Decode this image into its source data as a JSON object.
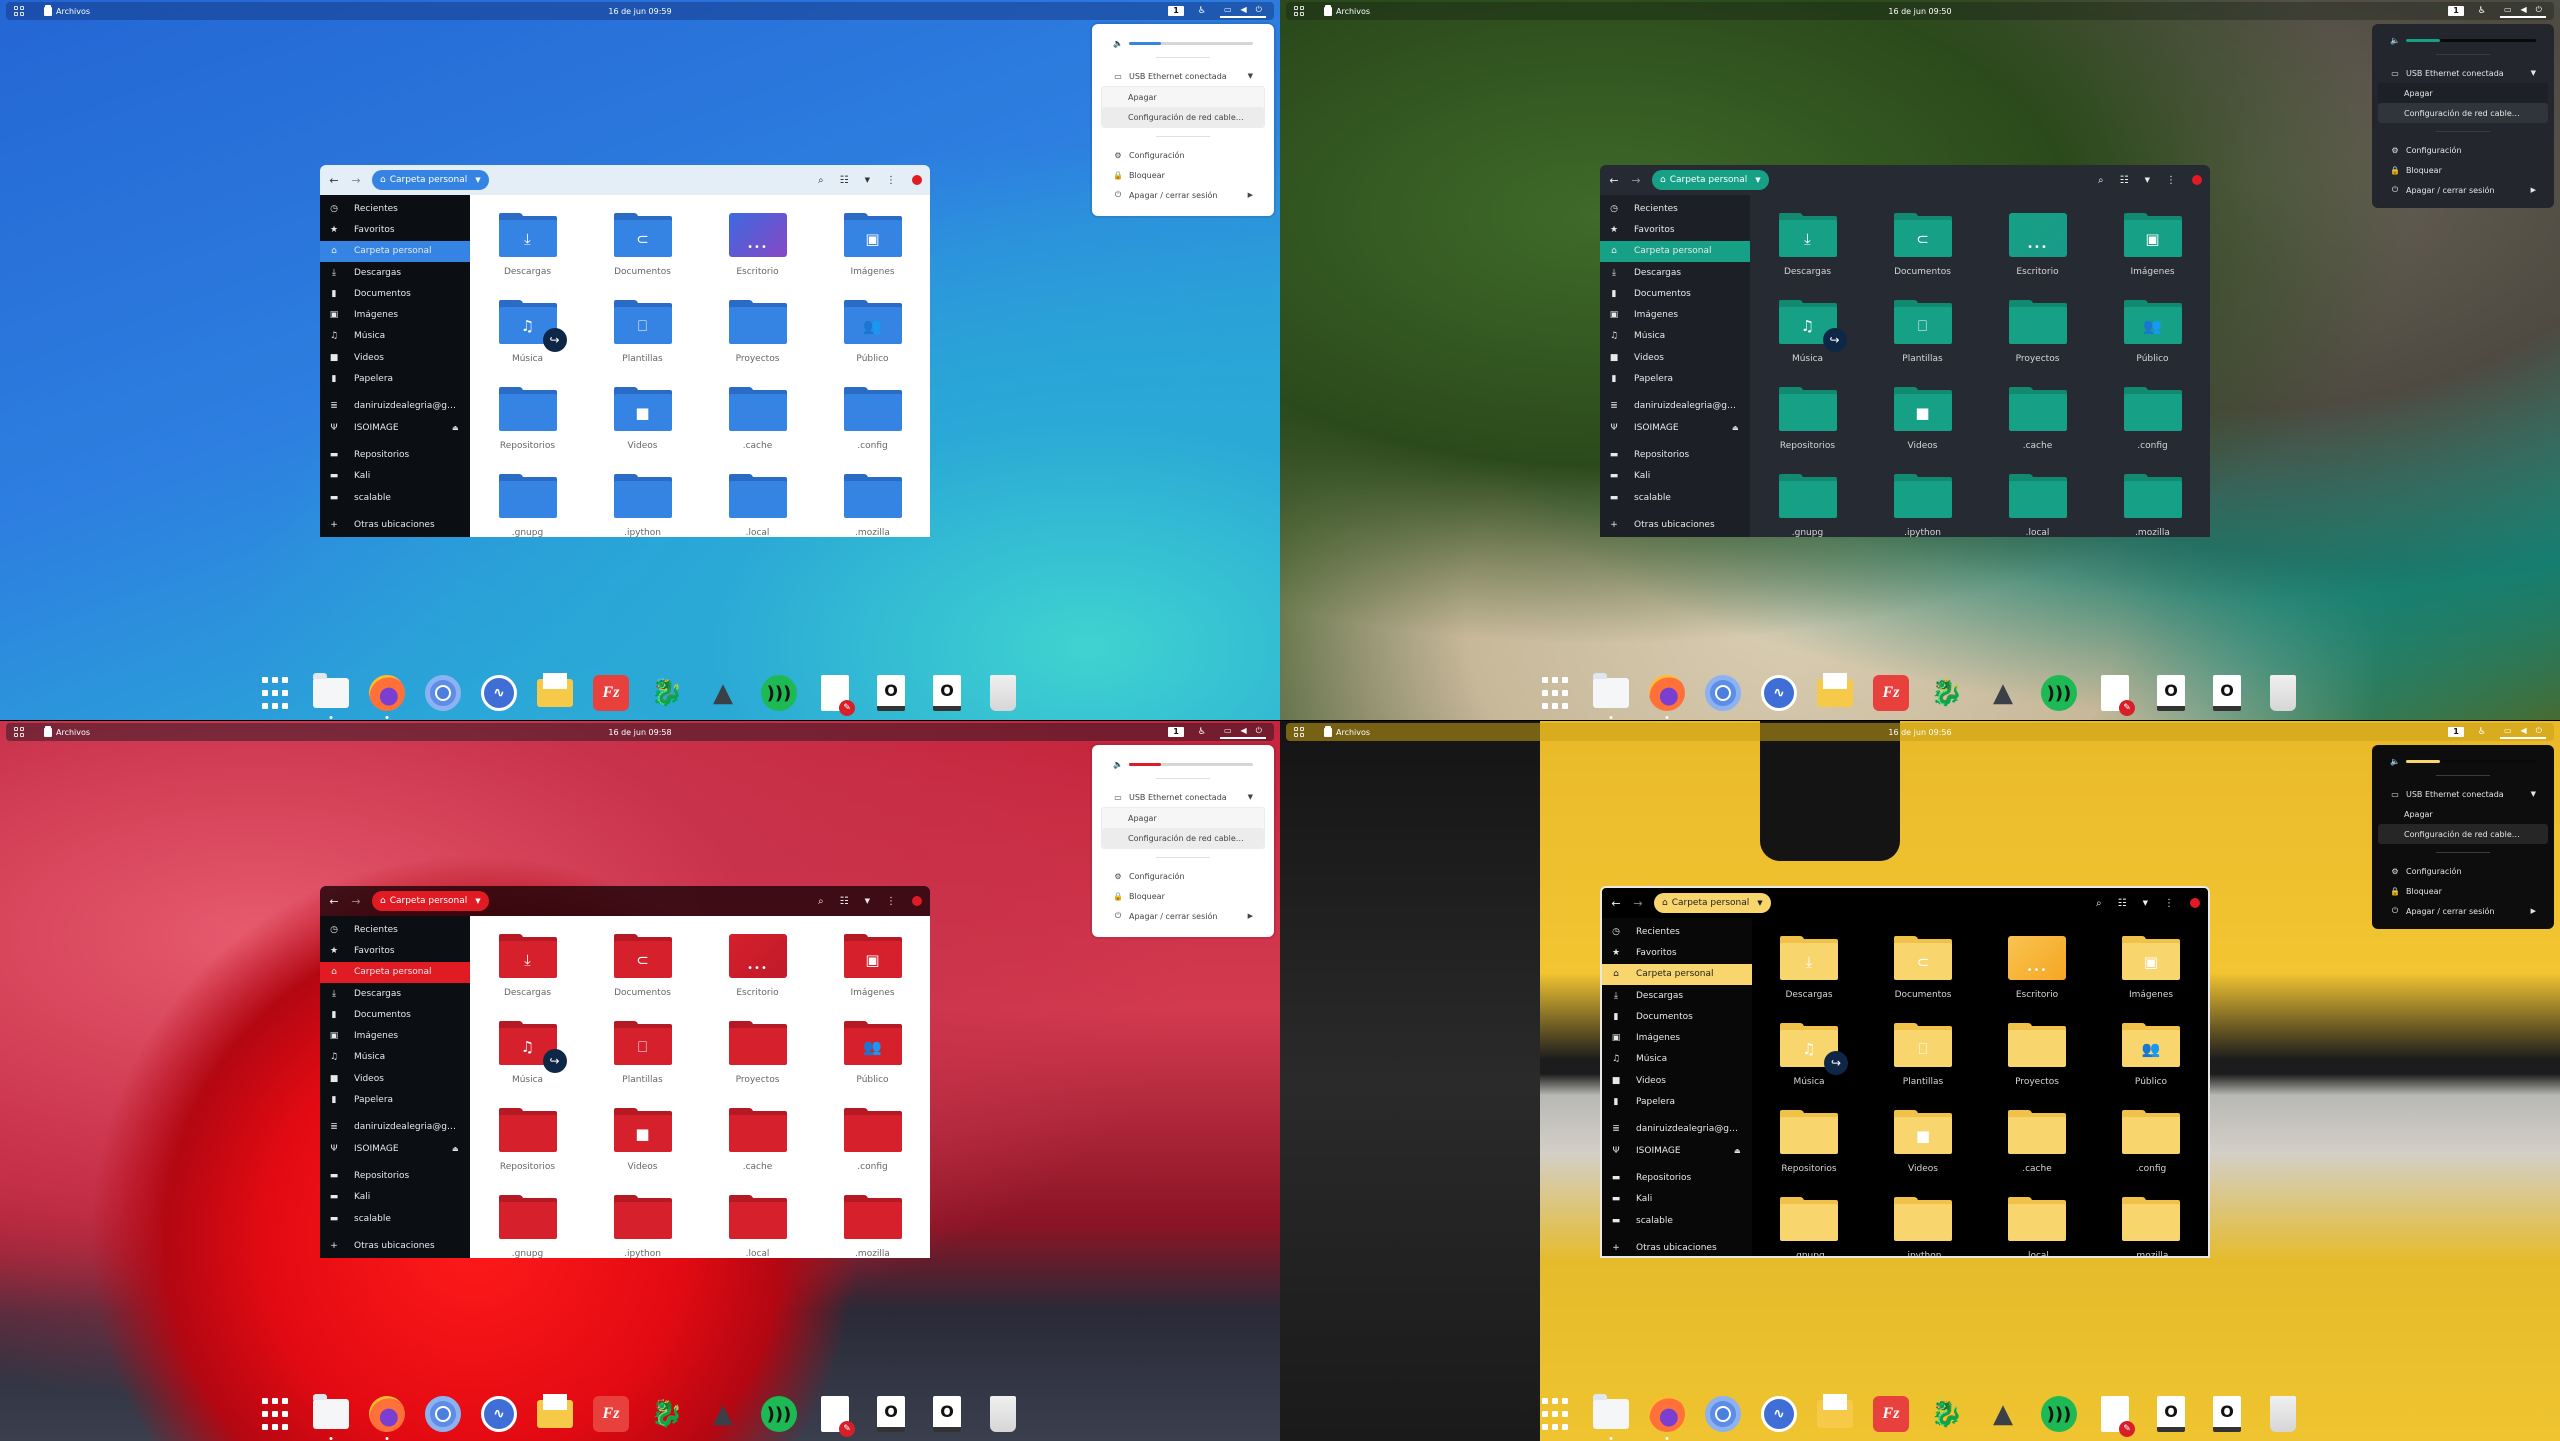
{
  "screens": [
    {
      "theme": "light-blue",
      "accent": "#3584e4",
      "folder_color": "#3584e4",
      "folder_dark": "#2a6cc5",
      "desktop_gradient": [
        "#3d6ae0",
        "#8847c5"
      ],
      "topbar": {
        "app_name": "Archivos",
        "clock": "16 de jun  09:59",
        "workspace": "1"
      },
      "volume_level": 0.26
    },
    {
      "theme": "dark-teal",
      "accent": "#16a085",
      "folder_color": "#16a085",
      "folder_dark": "#128a72",
      "desktop_gradient": [
        "#16a085",
        "#1a9a8a"
      ],
      "topbar": {
        "app_name": "Archivos",
        "clock": "16 de jun  09:50",
        "workspace": "1"
      },
      "volume_level": 0.26
    },
    {
      "theme": "light-red",
      "accent": "#e01b24",
      "folder_color": "#d6202c",
      "folder_dark": "#b51923",
      "desktop_gradient": [
        "#d6202c",
        "#c01a2a"
      ],
      "topbar": {
        "app_name": "Archivos",
        "clock": "16 de jun  09:58",
        "workspace": "1"
      },
      "volume_level": 0.26
    },
    {
      "theme": "dark-yellow",
      "accent": "#f9d56e",
      "folder_color": "#f9d56e",
      "folder_dark": "#f0c24a",
      "desktop_gradient": [
        "#f9c450",
        "#f5a623"
      ],
      "topbar": {
        "app_name": "Archivos",
        "clock": "16 de jun  09:56",
        "workspace": "1"
      },
      "volume_level": 0.26
    }
  ],
  "sysmenu": {
    "network": "USB Ethernet conectada",
    "network_off": "Apagar",
    "network_settings": "Configuración de red cable…",
    "settings": "Configuración",
    "lock": "Bloquear",
    "power": "Apagar / cerrar sesión"
  },
  "file_manager": {
    "path": "Carpeta personal",
    "sidebar": [
      {
        "label": "Recientes",
        "icon": "clock-icon"
      },
      {
        "label": "Favoritos",
        "icon": "star-icon"
      },
      {
        "label": "Carpeta personal",
        "icon": "home-icon",
        "active": true
      },
      {
        "label": "Descargas",
        "icon": "download-icon"
      },
      {
        "label": "Documentos",
        "icon": "document-icon"
      },
      {
        "label": "Imágenes",
        "icon": "image-icon"
      },
      {
        "label": "Música",
        "icon": "music-icon"
      },
      {
        "label": "Videos",
        "icon": "video-icon"
      },
      {
        "label": "Papelera",
        "icon": "trash-icon"
      },
      {
        "label": "daniruizdealegria@g…",
        "icon": "network-drive-icon",
        "gap_before": true
      },
      {
        "label": "ISOIMAGE",
        "icon": "usb-icon",
        "eject": true
      },
      {
        "label": "Repositorios",
        "icon": "folder-icon",
        "gap_before": true
      },
      {
        "label": "Kali",
        "icon": "folder-icon"
      },
      {
        "label": "scalable",
        "icon": "folder-icon"
      },
      {
        "label": "Otras ubicaciones",
        "icon": "plus-icon",
        "gap_before": true
      }
    ],
    "files": [
      {
        "name": "Descargas",
        "emblem": "download"
      },
      {
        "name": "Documentos",
        "emblem": "attachment"
      },
      {
        "name": "Escritorio",
        "emblem": "desktop"
      },
      {
        "name": "Imágenes",
        "emblem": "image"
      },
      {
        "name": "Música",
        "emblem": "music",
        "symlink": true
      },
      {
        "name": "Plantillas",
        "emblem": "template"
      },
      {
        "name": "Proyectos",
        "emblem": ""
      },
      {
        "name": "Público",
        "emblem": "people"
      },
      {
        "name": "Repositorios",
        "emblem": ""
      },
      {
        "name": "Videos",
        "emblem": "video"
      },
      {
        "name": ".cache",
        "emblem": ""
      },
      {
        "name": ".config",
        "emblem": ""
      },
      {
        "name": ".gnupg",
        "emblem": ""
      },
      {
        "name": ".ipython",
        "emblem": ""
      },
      {
        "name": ".local",
        "emblem": ""
      },
      {
        "name": ".mozilla",
        "emblem": ""
      }
    ]
  },
  "dock": [
    {
      "name": "show-applications",
      "kind": "apps"
    },
    {
      "name": "files",
      "kind": "files",
      "running": true
    },
    {
      "name": "firefox",
      "kind": "firefox",
      "running": true
    },
    {
      "name": "chromium",
      "kind": "chromium"
    },
    {
      "name": "system-monitor",
      "kind": "monitor"
    },
    {
      "name": "mail",
      "kind": "mail"
    },
    {
      "name": "filezilla",
      "kind": "fz",
      "glyph": "Fz"
    },
    {
      "name": "dragon",
      "kind": "dragon",
      "glyph": "🐉"
    },
    {
      "name": "inkscape",
      "kind": "inkscape",
      "glyph": "▲"
    },
    {
      "name": "spotify",
      "kind": "spotify",
      "glyph": ")))"
    },
    {
      "name": "text-editor",
      "kind": "doc"
    },
    {
      "name": "drive-1",
      "kind": "drive",
      "glyph": "O"
    },
    {
      "name": "drive-2",
      "kind": "drive",
      "glyph": "O"
    },
    {
      "name": "trash",
      "kind": "trash"
    }
  ]
}
